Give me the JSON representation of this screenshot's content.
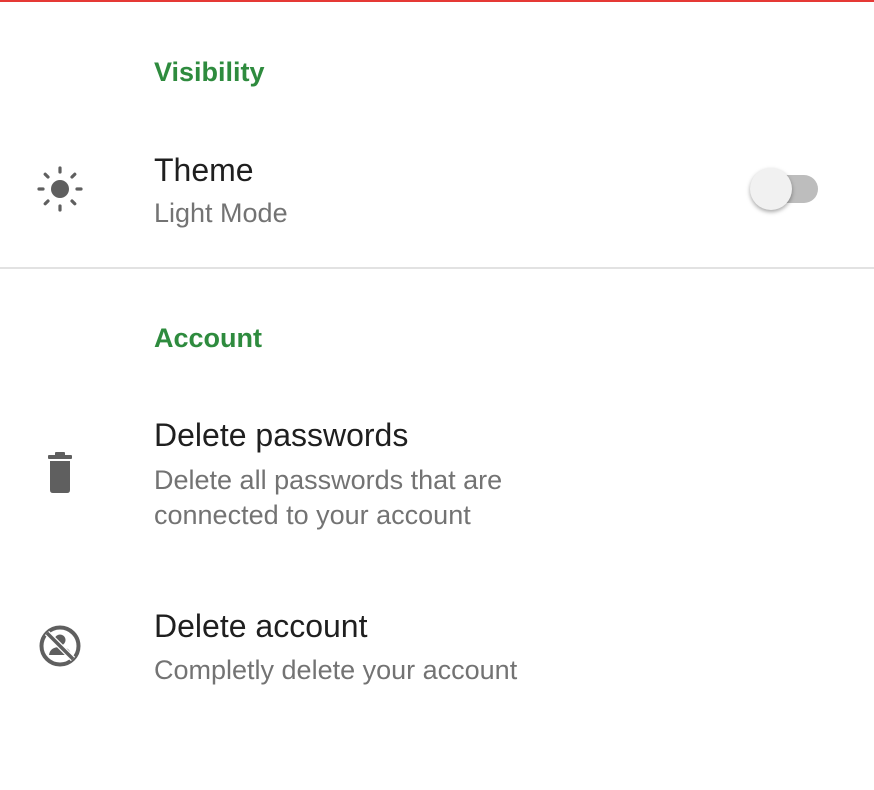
{
  "accent_color": "#2e8b3e",
  "sections": {
    "visibility": {
      "header": "Visibility",
      "theme": {
        "title": "Theme",
        "summary": "Light Mode",
        "icon": "brightness-sun-icon",
        "switch_on": false
      }
    },
    "account": {
      "header": "Account",
      "delete_passwords": {
        "title": "Delete passwords",
        "summary_line1": "Delete all passwords that are",
        "summary_line2": "connected to your account",
        "icon": "trash-icon"
      },
      "delete_account": {
        "title": "Delete account",
        "summary": "Completly delete your account",
        "icon": "account-off-icon"
      }
    }
  }
}
